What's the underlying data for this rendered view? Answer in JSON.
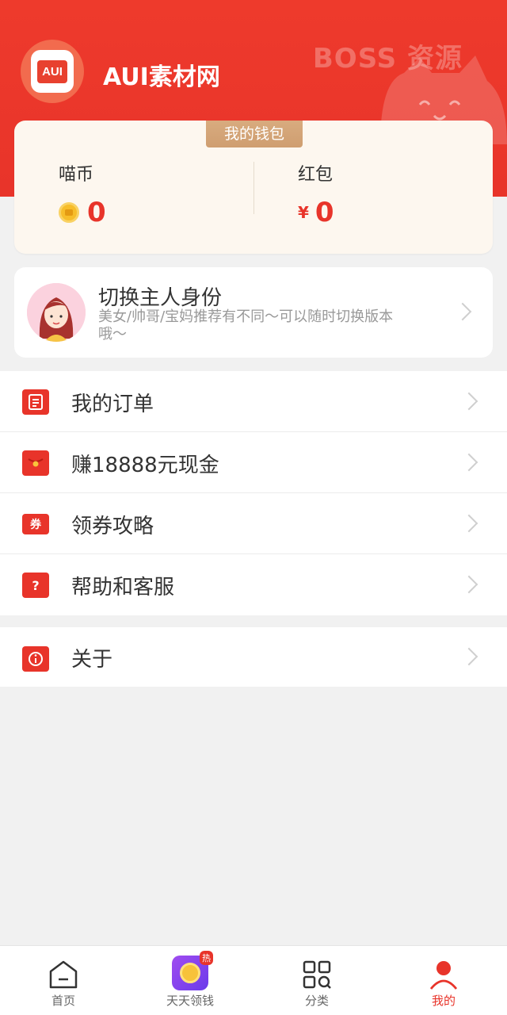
{
  "header": {
    "app_title": "AUI素材网",
    "logo_text": "AUI",
    "watermark": "BOSS 资源"
  },
  "wallet": {
    "tag": "我的钱包",
    "coins_label": "喵币",
    "coins_value": "0",
    "redpacket_label": "红包",
    "currency_symbol": "¥",
    "redpacket_value": "0"
  },
  "identity": {
    "title": "切换主人身份",
    "desc": "美女/帅哥/宝妈推荐有不同～可以随时切换版本哦～"
  },
  "menu": {
    "items": [
      {
        "label": "我的订单",
        "icon": "order-icon"
      },
      {
        "label": "赚18888元现金",
        "icon": "red-packet-icon"
      },
      {
        "label": "领券攻略",
        "icon": "coupon-icon",
        "icon_text": "券"
      },
      {
        "label": "帮助和客服",
        "icon": "help-icon",
        "icon_text": "?"
      }
    ],
    "about_label": "关于"
  },
  "tabbar": {
    "tabs": [
      {
        "label": "首页",
        "icon": "home-icon"
      },
      {
        "label": "天天领钱",
        "icon": "daily-money-icon",
        "badge": "热"
      },
      {
        "label": "分类",
        "icon": "category-icon"
      },
      {
        "label": "我的",
        "icon": "profile-icon",
        "active": true
      }
    ]
  },
  "colors": {
    "brand_red": "#e8342a",
    "gold": "#cf9e70",
    "background": "#f1f1f1"
  }
}
